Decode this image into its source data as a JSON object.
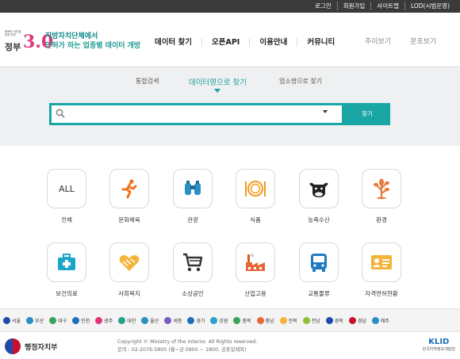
{
  "topbar": {
    "links": [
      "로그인",
      "회원가입",
      "사이트맵",
      "LOD(시범운영)"
    ]
  },
  "header": {
    "logo_small": "행복한 국민을 위한 정부",
    "logo_gov": "정부",
    "logo_num": "3.0",
    "tagline_1": "지방자치단체에서",
    "tagline_2": "인허가 하는 업종별 데이터 개방",
    "nav": [
      "데이터 찾기",
      "오픈API",
      "이용안내",
      "커뮤니티"
    ],
    "nav_secondary": [
      "추이보기",
      "분포보기"
    ]
  },
  "search": {
    "tabs": [
      "통합검색",
      "데이터명으로 찾기",
      "업소명으로 찾기"
    ],
    "active_tab": "데이터명으로 찾기",
    "input_value": "",
    "input_placeholder": "",
    "button_label": "찾기",
    "accent": "#1aa6a5"
  },
  "categories": [
    {
      "label": "전체",
      "icon": "all-text",
      "text": "ALL"
    },
    {
      "label": "문화체육",
      "icon": "running-person-icon"
    },
    {
      "label": "관광",
      "icon": "binoculars-icon"
    },
    {
      "label": "식품",
      "icon": "plate-fork-knife-icon"
    },
    {
      "label": "농축수산",
      "icon": "cow-icon"
    },
    {
      "label": "환경",
      "icon": "tree-icon"
    },
    {
      "label": "보건의료",
      "icon": "first-aid-kit-icon"
    },
    {
      "label": "사회복지",
      "icon": "heart-hands-icon"
    },
    {
      "label": "소상공인",
      "icon": "shopping-cart-icon"
    },
    {
      "label": "산업고용",
      "icon": "factory-icon"
    },
    {
      "label": "교통물류",
      "icon": "bus-icon"
    },
    {
      "label": "자격면허현황",
      "icon": "id-card-icon"
    }
  ],
  "regions": [
    "서울",
    "부산",
    "대구",
    "인천",
    "광주",
    "대전",
    "울산",
    "세종",
    "경기",
    "강원",
    "충북",
    "충남",
    "전북",
    "전남",
    "경북",
    "경남",
    "제주"
  ],
  "footer": {
    "ministry": "행정자치부",
    "copyright": "Copyright © Ministry of the Interior. All Rights reserved.",
    "contact": "문의 : 02-2076-5800 (월~금 0900 ~ 1800, 공휴일제외)",
    "klid": "KLID",
    "klid_sub": "한국지역정보개발원"
  }
}
